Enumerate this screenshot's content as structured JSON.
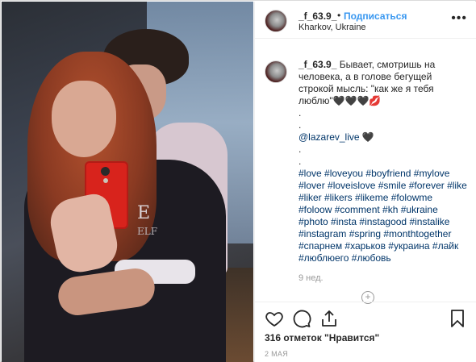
{
  "post": {
    "username": "_f_63.9_",
    "separator": "•",
    "follow_label": "Подписаться",
    "location": "Kharkov, Ukraine",
    "more_icon": "more-options-icon"
  },
  "photo": {
    "shirt_print_1": "E",
    "shirt_print_2": "ELF"
  },
  "caption": {
    "username": "_f_63.9_",
    "text": "Бывает, смотришь на человека, а в голове бегущей строкой мысль: \"как же я тебя люблю\"🖤🖤🖤💋",
    "dot1": ".",
    "dot2": ".",
    "mention": "@lazarev_live 🖤",
    "dot3": ".",
    "dot4": ".",
    "hashtags": "#love #loveyou #boyfriend #mylove #lover #loveislove #smile #forever #like #liker #likers #likeme #folowme #foloow #comment #kh #ukraine #photo #insta #instagood #instalike #instagram #spring #monthtogether #спарнем #харьков #украина #лайк #люблюего #любовь",
    "time_ago": "9 нед."
  },
  "load_more_symbol": "+",
  "likes_text": "316 отметок \"Нравится\"",
  "date_text": "2 МАЯ"
}
